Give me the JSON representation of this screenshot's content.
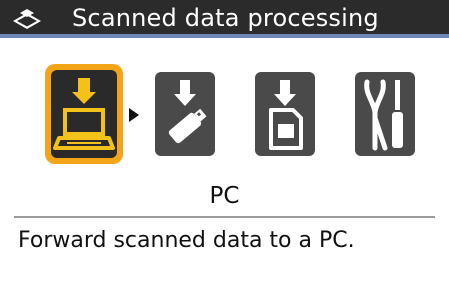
{
  "header": {
    "title": "Scanned data processing",
    "icon": "scanner-icon"
  },
  "functions": [
    {
      "id": "pc",
      "icon": "pc-laptop-icon",
      "selected": true
    },
    {
      "id": "usb",
      "icon": "usb-flash-drive-icon",
      "selected": false
    },
    {
      "id": "memory-card",
      "icon": "memory-card-icon",
      "selected": false
    },
    {
      "id": "settings",
      "icon": "tools-icon",
      "selected": false
    }
  ],
  "selected_function": {
    "name": "PC",
    "description": "Forward scanned data to a PC."
  },
  "colors": {
    "title_bar": "#2b2b2b",
    "title_accent": "#6f87b5",
    "selected_highlight": "#f3a417",
    "icon_tile": "#4a4a4a"
  }
}
